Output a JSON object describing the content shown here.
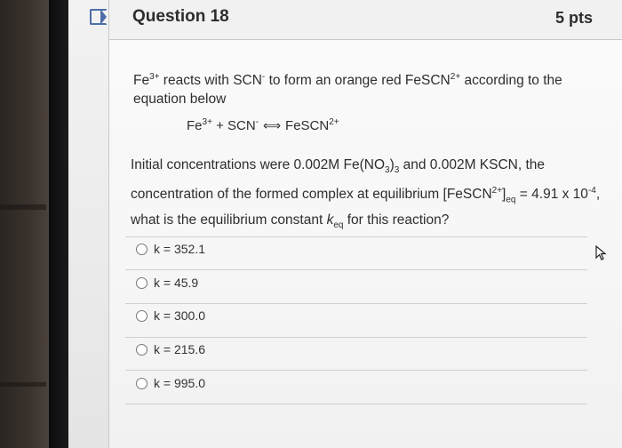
{
  "question": {
    "title": "Question 18",
    "points": "5 pts"
  },
  "stem": {
    "line1_fe": "Fe",
    "line1_fe_sup": "3+",
    "line1_mid": " reacts with SCN",
    "line1_scn_sup": "-",
    "line1_rest": " to form an orange red FeSCN",
    "line1_fescn_sup": "2+",
    "line1_end": " according to the equation below"
  },
  "equation": {
    "fe": "Fe",
    "fe_sup": "3+",
    "plus": " + SCN",
    "scn_sup": "-",
    "arrow": "⟺",
    "product": "FeSCN",
    "product_sup": "2+"
  },
  "body": {
    "text1": "Initial concentrations were 0.002M Fe(NO",
    "sub3": "3",
    "text2": ")",
    "sub3b": "3",
    "text3": " and 0.002M KSCN, the concentration of the formed complex at equilibrium [FeSCN",
    "sup2": "2+",
    "text4": "]",
    "sub_eq": "eq",
    "text5": " = 4.91 x 10",
    "exp": "-4",
    "text6": ", what is the equilibrium constant ",
    "k": "k",
    "k_sub": "eq",
    "text7": " for this reaction?"
  },
  "options": [
    {
      "label": "k = 352.1"
    },
    {
      "label": "k = 45.9"
    },
    {
      "label": "k = 300.0"
    },
    {
      "label": "k = 215.6"
    },
    {
      "label": "k = 995.0"
    }
  ],
  "icons": {
    "flag": "flag-icon",
    "cursor": "pointer-cursor-icon"
  },
  "colors": {
    "flag": "#4f6ea8",
    "card": "#f7f7f7",
    "text": "#2e2e2e"
  }
}
